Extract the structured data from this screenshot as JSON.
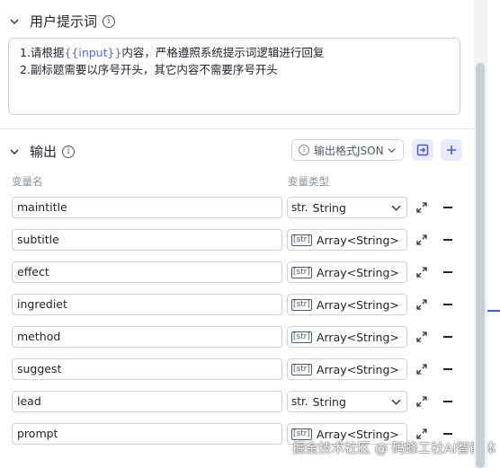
{
  "prompt_section": {
    "title": "用户提示词",
    "info_icon": "i",
    "line1_prefix": "1.请根据",
    "line1_var": "{{input}}",
    "line1_suffix": "内容，严格遵照系统提示词逻辑进行回复",
    "line2": "2.副标题需要以序号开头，其它内容不需要序号开头"
  },
  "output_section": {
    "title": "输出",
    "info_icon": "i",
    "format_button": "输出格式JSON",
    "col_name": "变量名",
    "col_type": "变量类型",
    "rows": [
      {
        "name": "maintitle",
        "type_icon": "str.",
        "type": "String"
      },
      {
        "name": "subtitle",
        "type_icon": "[str]",
        "type": "Array<String>"
      },
      {
        "name": "effect",
        "type_icon": "[str]",
        "type": "Array<String>"
      },
      {
        "name": "ingrediet",
        "type_icon": "[str]",
        "type": "Array<String>"
      },
      {
        "name": "method",
        "type_icon": "[str]",
        "type": "Array<String>"
      },
      {
        "name": "suggest",
        "type_icon": "[str]",
        "type": "Array<String>"
      },
      {
        "name": "lead",
        "type_icon": "str.",
        "type": "String"
      },
      {
        "name": "prompt",
        "type_icon": "[str]",
        "type": "Array<String>"
      }
    ]
  },
  "watermark": "掘金技术社区 @ 码蜂工社AI智能体",
  "icons": [
    "chevron-down-icon",
    "info-icon",
    "import-icon",
    "plus-icon",
    "expand-icon",
    "minus-icon"
  ],
  "colors": {
    "accent": "#3d5afe",
    "button_bg": "#e8ebff",
    "variable_text": "#5a6bd8"
  }
}
